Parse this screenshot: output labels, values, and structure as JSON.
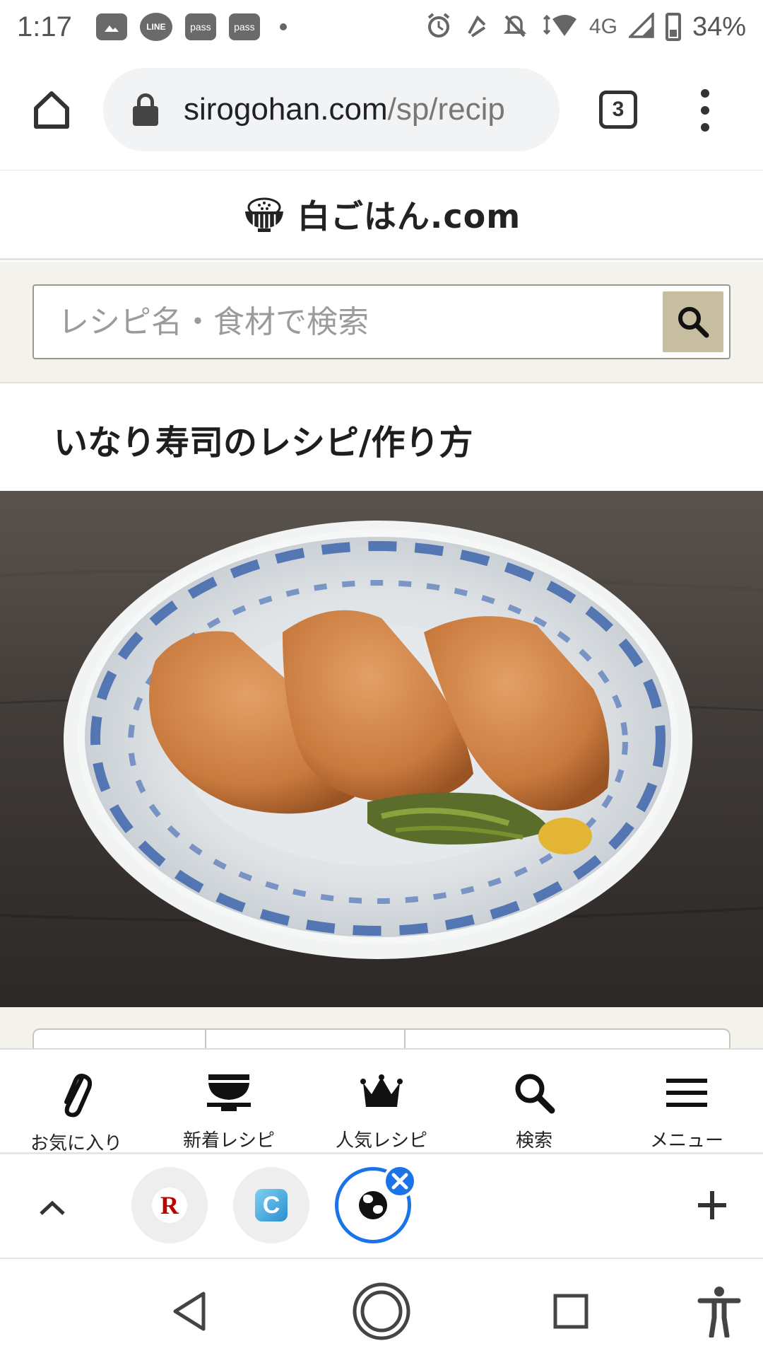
{
  "status_bar": {
    "time": "1:17",
    "notification_icons": [
      "image-icon",
      "line-icon",
      "pass-icon",
      "pass-icon"
    ],
    "line_label": "LINE",
    "pass_label": "pass",
    "network": "4G",
    "battery": "34%"
  },
  "browser": {
    "url_host": "sirogohan.com",
    "url_path": "/sp/recip",
    "tab_count": "3"
  },
  "site": {
    "logo_text": "白ごはん.com",
    "search_placeholder": "レシピ名・食材で検索",
    "recipe_title": "いなり寿司のレシピ/作り方"
  },
  "bottom_nav": {
    "items": [
      {
        "label": "お気に入り",
        "icon": "paperclip-icon"
      },
      {
        "label": "新着レシピ",
        "icon": "rice-bowl-icon"
      },
      {
        "label": "人気レシピ",
        "icon": "crown-icon"
      },
      {
        "label": "検索",
        "icon": "search-icon"
      },
      {
        "label": "メニュー",
        "icon": "hamburger-menu-icon"
      }
    ]
  },
  "tab_strip": {
    "tabs": [
      {
        "favicon": "rakuten-icon",
        "glyph": "R"
      },
      {
        "favicon": "c-app-icon",
        "glyph": "C"
      },
      {
        "favicon": "globe-icon",
        "active": true
      }
    ]
  },
  "colors": {
    "accent_blue": "#1a73e8",
    "search_button": "#c7bea1",
    "search_band": "#f4f2ec"
  }
}
